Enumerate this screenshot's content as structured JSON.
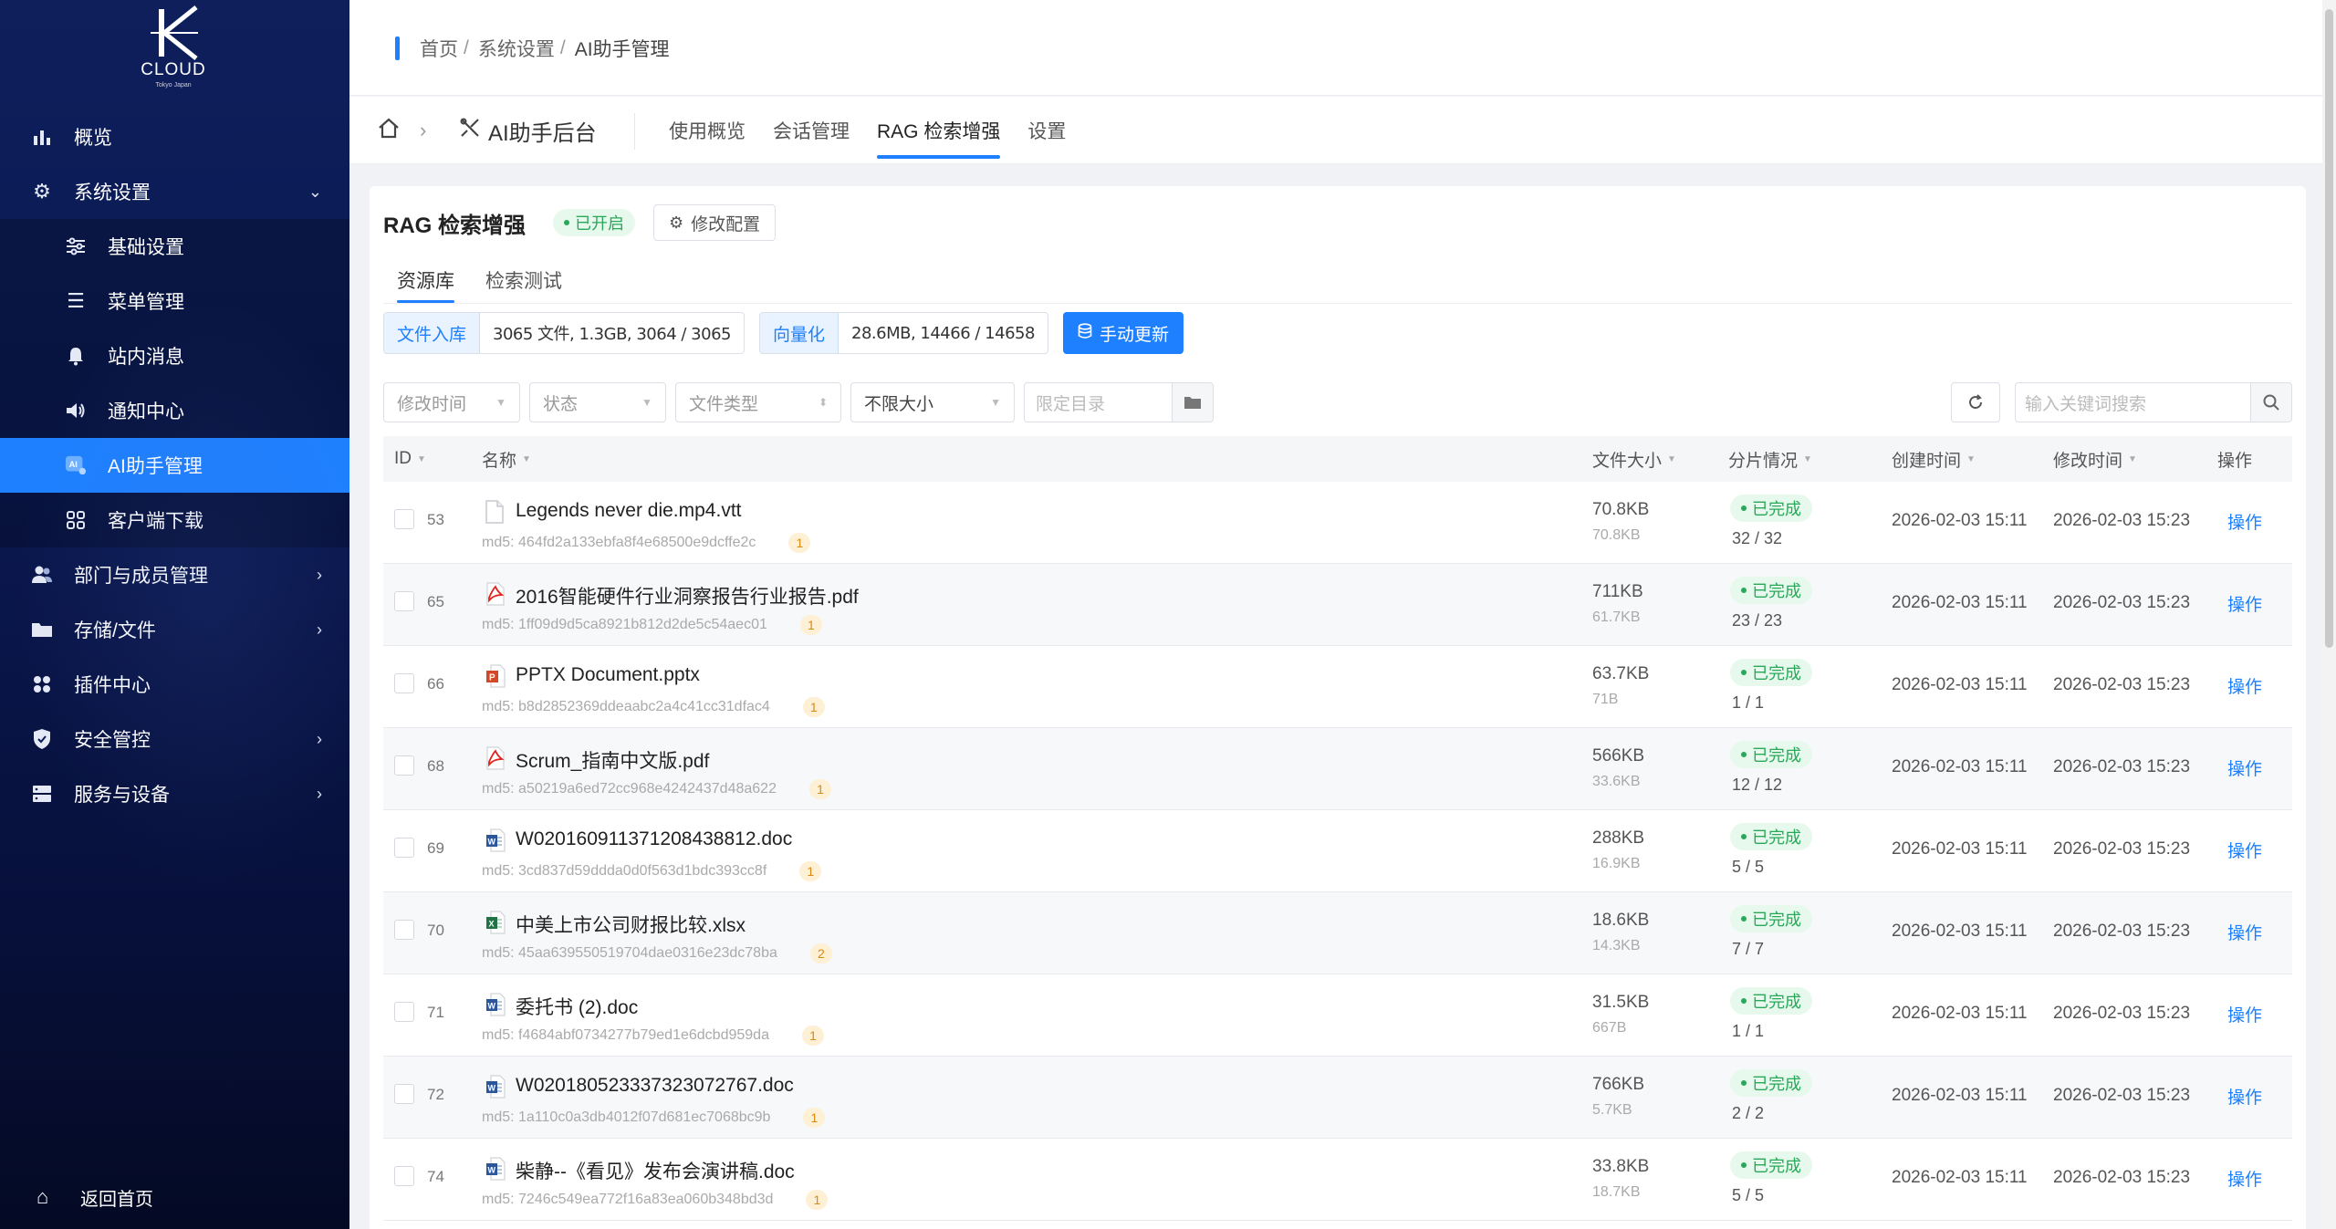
{
  "app": {
    "logo_text": "CLOUD",
    "logo_sub": "Tokyo Japan",
    "accent": "#1e80ff"
  },
  "sidebar": {
    "items": [
      {
        "label": "概览",
        "icon": "bar-chart-icon"
      },
      {
        "label": "系统设置",
        "icon": "gear-icon",
        "expanded": true
      },
      {
        "label": "基础设置",
        "icon": "sliders-icon"
      },
      {
        "label": "菜单管理",
        "icon": "menu-icon"
      },
      {
        "label": "站内消息",
        "icon": "bell-icon"
      },
      {
        "label": "通知中心",
        "icon": "speaker-icon"
      },
      {
        "label": "AI助手管理",
        "icon": "ai-icon",
        "active": true
      },
      {
        "label": "客户端下载",
        "icon": "grid-icon"
      },
      {
        "label": "部门与成员管理",
        "icon": "users-icon"
      },
      {
        "label": "存储/文件",
        "icon": "folder-icon"
      },
      {
        "label": "插件中心",
        "icon": "plugin-icon"
      },
      {
        "label": "安全管控",
        "icon": "shield-icon"
      },
      {
        "label": "服务与设备",
        "icon": "server-icon"
      }
    ],
    "back_home": "返回首页"
  },
  "breadcrumb": {
    "home": "首页",
    "sys": "系统设置",
    "current": "AI助手管理"
  },
  "subbar": {
    "app_title": "AI助手后台",
    "tabs": [
      "使用概览",
      "会话管理",
      "RAG 检索增强",
      "设置"
    ],
    "active_tab": "RAG 检索增强"
  },
  "card": {
    "title": "RAG 检索增强",
    "status": "已开启",
    "config_button": "修改配置",
    "inner_tabs": [
      "资源库",
      "检索测试"
    ]
  },
  "stats": {
    "ingest_label": "文件入库",
    "ingest_value": "3065 文件, 1.3GB, 3064 / 3065",
    "vector_label": "向量化",
    "vector_value": "28.6MB, 14466 / 14658",
    "update_button": "手动更新"
  },
  "filters": {
    "modified": "修改时间",
    "status": "状态",
    "filetype": "文件类型",
    "size": "不限大小",
    "dir_placeholder": "限定目录",
    "search_placeholder": "输入关键词搜索"
  },
  "table": {
    "headers": {
      "id": "ID",
      "name": "名称",
      "size": "文件大小",
      "chunks": "分片情况",
      "created": "创建时间",
      "modified": "修改时间",
      "ops": "操作"
    },
    "rows": [
      {
        "id": "53",
        "type": "file",
        "name": "Legends never die.mp4.vtt",
        "md5": "md5: 464fd2a133ebfa8f4e68500e9dcffe2c",
        "count": "1",
        "size": "70.8KB",
        "size2": "70.8KB",
        "status": "已完成",
        "chunks": "32 / 32",
        "created": "2026-02-03 15:11",
        "modified": "2026-02-03 15:23",
        "op": "操作"
      },
      {
        "id": "65",
        "type": "pdf",
        "name": "2016智能硬件行业洞察报告行业报告.pdf",
        "md5": "md5: 1ff09d9d5ca8921b812d2de5c54aec01",
        "count": "1",
        "size": "711KB",
        "size2": "61.7KB",
        "status": "已完成",
        "chunks": "23 / 23",
        "created": "2026-02-03 15:11",
        "modified": "2026-02-03 15:23",
        "op": "操作"
      },
      {
        "id": "66",
        "type": "ppt",
        "name": "PPTX Document.pptx",
        "md5": "md5: b8d2852369ddeaabc2a4c41cc31dfac4",
        "count": "1",
        "size": "63.7KB",
        "size2": "71B",
        "status": "已完成",
        "chunks": "1 / 1",
        "created": "2026-02-03 15:11",
        "modified": "2026-02-03 15:23",
        "op": "操作"
      },
      {
        "id": "68",
        "type": "pdf",
        "name": "Scrum_指南中文版.pdf",
        "md5": "md5: a50219a6ed72cc968e4242437d48a622",
        "count": "1",
        "size": "566KB",
        "size2": "33.6KB",
        "status": "已完成",
        "chunks": "12 / 12",
        "created": "2026-02-03 15:11",
        "modified": "2026-02-03 15:23",
        "op": "操作"
      },
      {
        "id": "69",
        "type": "doc",
        "name": "W020160911371208438812.doc",
        "md5": "md5: 3cd837d59ddda0d0f563d1bdc393cc8f",
        "count": "1",
        "size": "288KB",
        "size2": "16.9KB",
        "status": "已完成",
        "chunks": "5 / 5",
        "created": "2026-02-03 15:11",
        "modified": "2026-02-03 15:23",
        "op": "操作"
      },
      {
        "id": "70",
        "type": "xls",
        "name": "中美上市公司财报比较.xlsx",
        "md5": "md5: 45aa639550519704dae0316e23dc78ba",
        "count": "2",
        "size": "18.6KB",
        "size2": "14.3KB",
        "status": "已完成",
        "chunks": "7 / 7",
        "created": "2026-02-03 15:11",
        "modified": "2026-02-03 15:23",
        "op": "操作"
      },
      {
        "id": "71",
        "type": "doc",
        "name": "委托书 (2).doc",
        "md5": "md5: f4684abf0734277b79ed1e6dcbd959da",
        "count": "1",
        "size": "31.5KB",
        "size2": "667B",
        "status": "已完成",
        "chunks": "1 / 1",
        "created": "2026-02-03 15:11",
        "modified": "2026-02-03 15:23",
        "op": "操作"
      },
      {
        "id": "72",
        "type": "doc",
        "name": "W020180523337323072767.doc",
        "md5": "md5: 1a110c0a3db4012f07d681ec7068bc9b",
        "count": "1",
        "size": "766KB",
        "size2": "5.7KB",
        "status": "已完成",
        "chunks": "2 / 2",
        "created": "2026-02-03 15:11",
        "modified": "2026-02-03 15:23",
        "op": "操作"
      },
      {
        "id": "74",
        "type": "doc",
        "name": "柴静--《看见》发布会演讲稿.doc",
        "md5": "md5: 7246c549ea772f16a83ea060b348bd3d",
        "count": "1",
        "size": "33.8KB",
        "size2": "18.7KB",
        "status": "已完成",
        "chunks": "5 / 5",
        "created": "2026-02-03 15:11",
        "modified": "2026-02-03 15:23",
        "op": "操作"
      }
    ]
  }
}
